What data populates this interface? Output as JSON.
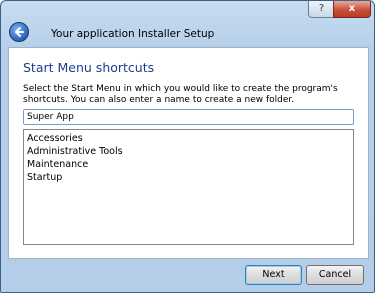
{
  "window": {
    "title": "Your application Installer Setup",
    "help_glyph": "?",
    "close_glyph": "x"
  },
  "page": {
    "heading": "Start Menu shortcuts",
    "description": "Select the Start Menu in which you would like to create the program's shortcuts. You can also enter a name to create a new folder."
  },
  "folder_input": {
    "value": "Super App"
  },
  "folders": [
    "Accessories",
    "Administrative Tools",
    "Maintenance",
    "Startup"
  ],
  "buttons": {
    "next": "Next",
    "cancel": "Cancel"
  }
}
